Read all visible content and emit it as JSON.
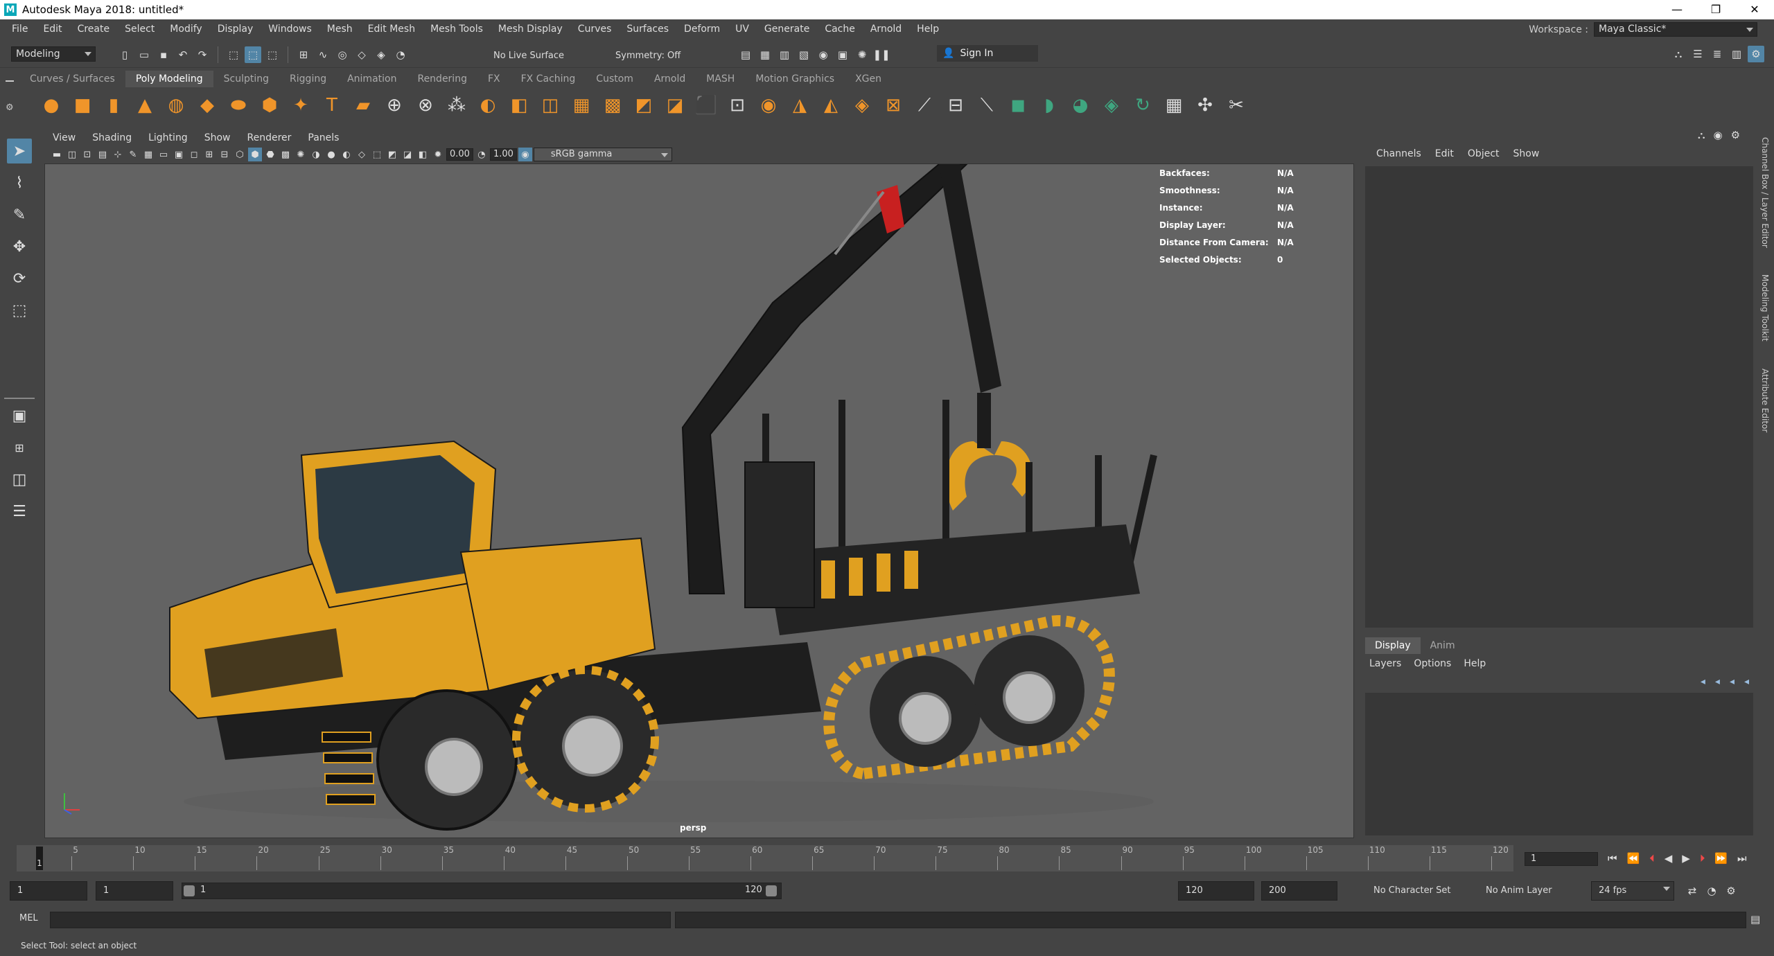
{
  "window": {
    "title": "Autodesk Maya 2018: untitled*",
    "app_icon": "M",
    "controls": [
      "—",
      "❐",
      "✕"
    ]
  },
  "menubar": [
    "File",
    "Edit",
    "Create",
    "Select",
    "Modify",
    "Display",
    "Windows",
    "Mesh",
    "Edit Mesh",
    "Mesh Tools",
    "Mesh Display",
    "Curves",
    "Surfaces",
    "Deform",
    "UV",
    "Generate",
    "Cache",
    "Arnold",
    "Help"
  ],
  "workspace": {
    "label": "Workspace :",
    "value": "Maya Classic*"
  },
  "statusline": {
    "mode": "Modeling",
    "live_surface": "No Live Surface",
    "symmetry": "Symmetry: Off",
    "signin": "Sign In"
  },
  "shelf": {
    "tabs": [
      "Curves / Surfaces",
      "Poly Modeling",
      "Sculpting",
      "Rigging",
      "Animation",
      "Rendering",
      "FX",
      "FX Caching",
      "Custom",
      "Arnold",
      "MASH",
      "Motion Graphics",
      "XGen"
    ],
    "active_tab": "Poly Modeling"
  },
  "viewport": {
    "menus": [
      "View",
      "Shading",
      "Lighting",
      "Show",
      "Renderer",
      "Panels"
    ],
    "exposure": "0.00",
    "gamma": "1.00",
    "color_space": "sRGB gamma",
    "camera": "persp",
    "hud": [
      {
        "label": "Backfaces:",
        "value": "N/A"
      },
      {
        "label": "Smoothness:",
        "value": "N/A"
      },
      {
        "label": "Instance:",
        "value": "N/A"
      },
      {
        "label": "Display Layer:",
        "value": "N/A"
      },
      {
        "label": "Distance From Camera:",
        "value": "N/A"
      },
      {
        "label": "Selected Objects:",
        "value": "0"
      }
    ]
  },
  "channel_box": {
    "menus": [
      "Channels",
      "Edit",
      "Object",
      "Show"
    ]
  },
  "layer_editor": {
    "tabs": [
      "Display",
      "Anim"
    ],
    "active_tab": "Display",
    "menus": [
      "Layers",
      "Options",
      "Help"
    ]
  },
  "side_tabs": [
    "Channel Box / Layer Editor",
    "Modeling Toolkit",
    "Attribute Editor"
  ],
  "timeslider": {
    "ticks": [
      "5",
      "10",
      "15",
      "20",
      "25",
      "30",
      "35",
      "40",
      "45",
      "50",
      "55",
      "60",
      "65",
      "70",
      "75",
      "80",
      "85",
      "90",
      "95",
      "100",
      "105",
      "110",
      "115",
      "120"
    ],
    "current_frame": "1",
    "current_field": "1"
  },
  "range": {
    "start": "1",
    "playback_start": "1",
    "bar_start": "1",
    "bar_end": "120",
    "playback_end": "120",
    "end": "200",
    "character_set": "No Character Set",
    "anim_layer": "No Anim Layer",
    "fps": "24 fps"
  },
  "cmdline": {
    "label": "MEL"
  },
  "helpline": "Select Tool: select an object",
  "colors": {
    "accent": "#5285a6",
    "maya_yellow": "#e0a020",
    "shelf_orange": "#f0952a",
    "logo_teal": "#27b3c4"
  }
}
